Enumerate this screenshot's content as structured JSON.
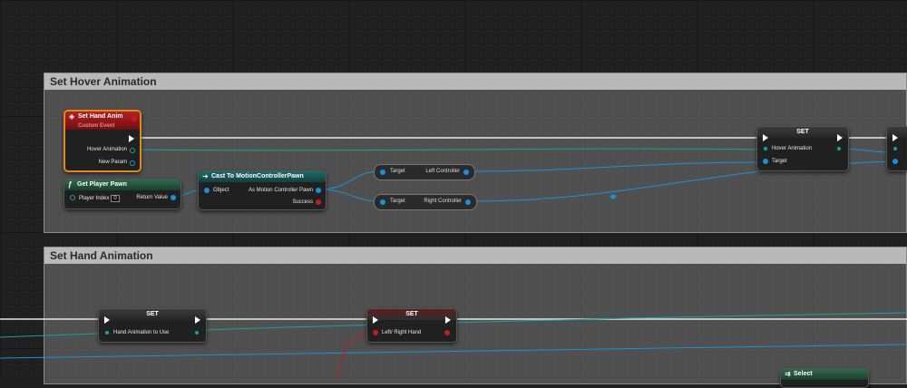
{
  "comments": [
    {
      "title": "Set Hover Animation"
    },
    {
      "title": "Set Hand Animation"
    }
  ],
  "nodes": {
    "custom_event": {
      "title": "Set Hand Anim",
      "subtitle": "Custom Event",
      "pins": {
        "hover_animation": "Hover Animation",
        "new_param": "New Param"
      }
    },
    "get_player_pawn": {
      "title": "Get Player Pawn",
      "player_index_label": "Player Index",
      "player_index_value": "0",
      "return_value": "Return Value"
    },
    "cast": {
      "title": "Cast To MotionControllerPawn",
      "object": "Object",
      "as_pawn": "As Motion Controller Pawn",
      "success": "Success"
    },
    "left_controller": {
      "target": "Target",
      "output": "Left Controller"
    },
    "right_controller": {
      "target": "Target",
      "output": "Right Controller"
    },
    "set_hover": {
      "title": "SET",
      "value_pin": "Hover Animation",
      "target_pin": "Target"
    },
    "set_hand_anim": {
      "title": "SET",
      "value_pin": "Hand Animation to Use"
    },
    "set_left_right": {
      "title": "SET",
      "value_pin": "Left/ Right Hand"
    },
    "select": {
      "title": "Select"
    }
  },
  "colors": {
    "event": "#b62020",
    "exec": "#ffffff",
    "object_pin": "#1e90d8",
    "struct_pin": "#17a39a",
    "bool_pin": "#c01e1e"
  }
}
